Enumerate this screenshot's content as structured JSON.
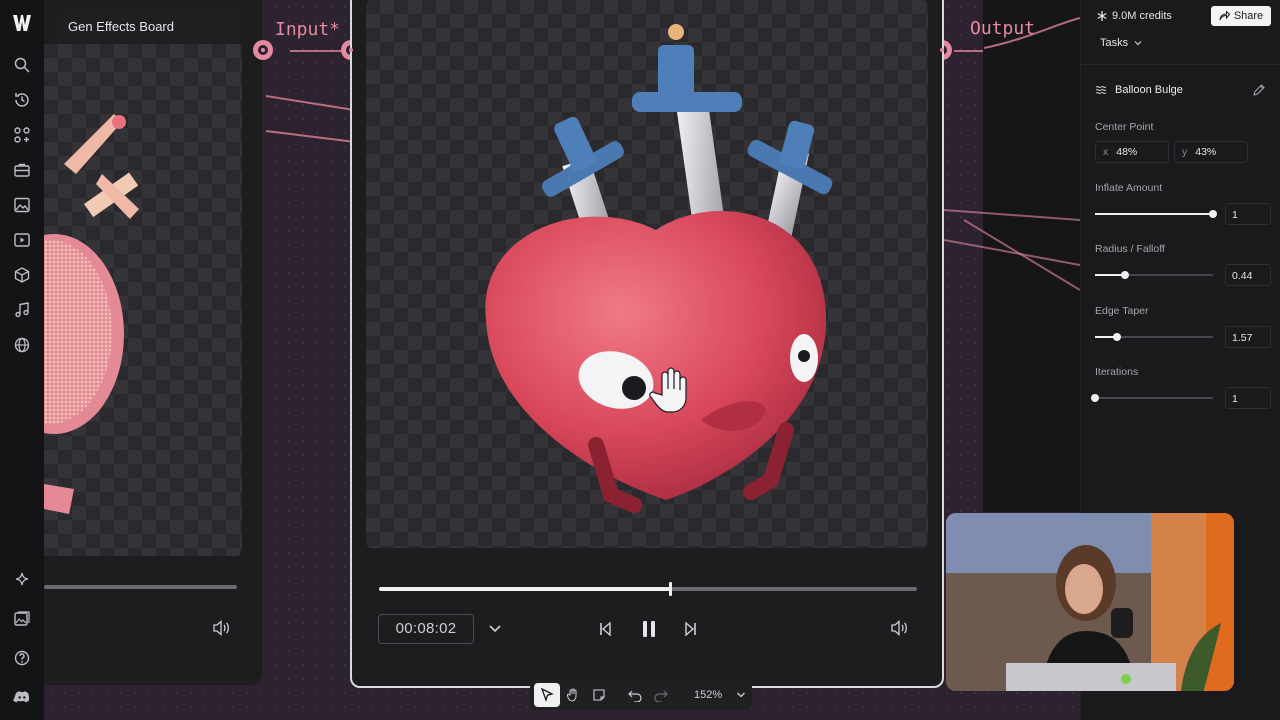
{
  "board": {
    "title": "Gen Effects Board"
  },
  "nodes": {
    "input_label": "Input*",
    "output_label": "Output"
  },
  "player": {
    "timecode": "00:08:02",
    "progress_fraction": 0.54
  },
  "header": {
    "credits": "9.0M credits",
    "share_label": "Share",
    "tasks_label": "Tasks"
  },
  "effect": {
    "name": "Balloon Bulge",
    "center_point": {
      "label": "Center Point",
      "x_axis": "x",
      "x": "48%",
      "y_axis": "y",
      "y": "43%"
    },
    "params": [
      {
        "label": "Inflate Amount",
        "value": "1",
        "fraction": 1.0
      },
      {
        "label": "Radius / Falloff",
        "value": "0.44",
        "fraction": 0.25
      },
      {
        "label": "Edge Taper",
        "value": "1.57",
        "fraction": 0.19
      },
      {
        "label": "Iterations",
        "value": "1",
        "fraction": 0.0
      }
    ]
  },
  "toolbar": {
    "zoom": "152%"
  },
  "icons": {
    "rail": [
      "logo-icon",
      "search-icon",
      "history-icon",
      "nodes-icon",
      "briefcase-icon",
      "image-icon",
      "video-icon",
      "cube-icon",
      "music-icon",
      "globe-icon"
    ],
    "rail_bottom": [
      "sparkle-icon",
      "gallery-icon",
      "help-icon",
      "discord-icon"
    ]
  },
  "colors": {
    "accent": "#e58aa0",
    "panel": "#1a1a1c",
    "canvas": "#2d2230"
  }
}
